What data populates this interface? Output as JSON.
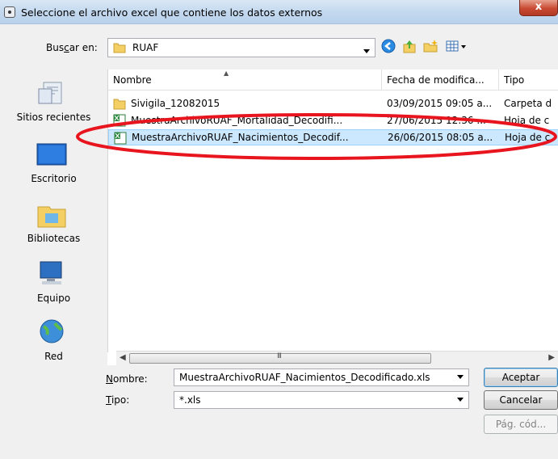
{
  "window": {
    "title": "Seleccione el archivo excel que contiene los datos externos",
    "close_label": "x"
  },
  "toolbar": {
    "lookin_label": "Buscar en:",
    "lookin_value": "RUAF",
    "icons": [
      "back-icon",
      "up-folder-icon",
      "new-folder-icon",
      "views-icon"
    ]
  },
  "places": [
    {
      "label": "Sitios recientes",
      "icon": "recent-places-icon"
    },
    {
      "label": "Escritorio",
      "icon": "desktop-icon"
    },
    {
      "label": "Bibliotecas",
      "icon": "libraries-icon"
    },
    {
      "label": "Equipo",
      "icon": "computer-icon"
    },
    {
      "label": "Red",
      "icon": "network-icon"
    }
  ],
  "columns": {
    "name": "Nombre",
    "date": "Fecha de modifica...",
    "type": "Tipo"
  },
  "files": [
    {
      "name": "Sivigila_12082015",
      "date": "03/09/2015 09:05 a...",
      "type": "Carpeta d",
      "icon": "folder-icon"
    },
    {
      "name": "MuestraArchivoRUAF_Mortalidad_Decodifi...",
      "date": "27/06/2015 12:36 ...",
      "type": "Hoja de c",
      "icon": "excel-file-icon"
    },
    {
      "name": "MuestraArchivoRUAF_Nacimientos_Decodif...",
      "date": "26/06/2015 08:05 a...",
      "type": "Hoja de c",
      "icon": "excel-file-icon",
      "selected": true
    }
  ],
  "scrollbar": {
    "grip": "III"
  },
  "bottom": {
    "name_label": "Nombre:",
    "name_value": "MuestraArchivoRUAF_Nacimientos_Decodificado.xls",
    "type_label": "Tipo:",
    "type_value": "*.xls",
    "accept_label": "Aceptar",
    "cancel_label": "Cancelar",
    "codepage_label": "Pág. cód..."
  },
  "colors": {
    "highlight_ellipse": "#e8141e",
    "selection": "#cce8ff"
  }
}
